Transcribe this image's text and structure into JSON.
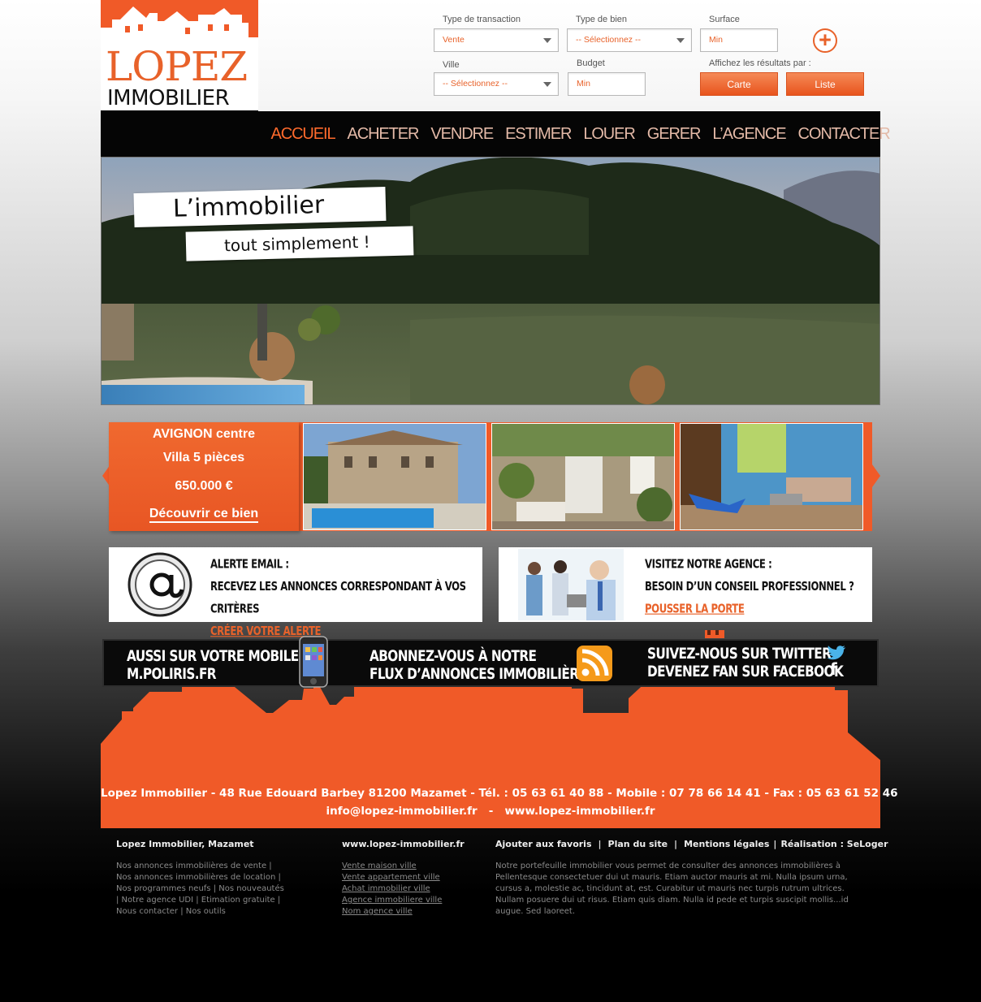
{
  "brand": {
    "name_line1": "LOPEZ",
    "name_line2": "IMMOBILIER",
    "color": "#f05a28"
  },
  "search": {
    "transaction_label": "Type de transaction",
    "transaction_value": "Vente",
    "bien_label": "Type de bien",
    "bien_value": "-- Sélectionnez --",
    "surface_label": "Surface",
    "surface_placeholder": "Min",
    "ville_label": "Ville",
    "ville_value": "-- Sélectionnez --",
    "budget_label": "Budget",
    "budget_placeholder": "Min",
    "results_label": "Affichez les résultats par :",
    "map_button": "Carte",
    "list_button": "Liste",
    "plus_icon": "plus-circle-icon"
  },
  "nav": {
    "items": [
      "ACCUEIL",
      "ACHETER",
      "VENDRE",
      "ESTIMER",
      "LOUER",
      "GERER",
      "L’AGENCE",
      "CONTACTER"
    ],
    "active": "ACCUEIL"
  },
  "hero": {
    "line1": "L’immobilier",
    "line2": "tout simplement !"
  },
  "carousel": {
    "city": "AVIGNON centre",
    "type": "Villa 5 pièces",
    "price": "650.000 €",
    "cta": "Découvrir ce bien"
  },
  "alert_box": {
    "title": "Alerte email :",
    "text": "Recevez les annonces correspondant à vos critères",
    "link": "Créer votre alerte"
  },
  "agency_box": {
    "title": "Visitez notre agence :",
    "text": "Besoin d’un conseil professionnel ?",
    "link": "Pousser la porte"
  },
  "social": {
    "mobile_line1": "Aussi sur votre  mobile",
    "mobile_line2": "M.POLIRIS.FR",
    "rss_line1": "Abonnez-vous à notre",
    "rss_line2": "flux d’annonces immobilières",
    "twitter_line": "Suivez-nous sur Twitter",
    "facebook_line": "Devenez fan sur Facebook"
  },
  "contact": {
    "line1": "Lopez Immobilier  -  48 Rue Edouard Barbey 81200 Mazamet  -  Tél. : 05 63 61 40 88  - Mobile : 07 78 66 14 41  - Fax : 05 63 61 52 46",
    "email": "info@lopez-immobilier.fr",
    "website": "www.lopez-immobilier.fr"
  },
  "footer": {
    "col1_title": "Lopez Immobilier, Mazamet",
    "col1_lines": [
      "Nos annonces immobilières de vente |",
      "Nos annonces immobilières de location |",
      "Nos programmes neufs | Nos nouveautés",
      "| Notre agence UDI | Etimation gratuite |",
      "Nous contacter | Nos outils"
    ],
    "col2_title": "www.lopez-immobilier.fr",
    "col2_links": [
      "Vente maison ville",
      "Vente appartement ville",
      "Achat immobilier ville",
      "Agence immobiliere ville ",
      "Nom agence ville"
    ],
    "col3_links": [
      "Ajouter aux favoris",
      "Plan du site",
      "Mentions légales",
      "Réalisation : SeLoger"
    ],
    "col3_text": "Notre portefeuille immobilier vous permet de consulter des annonces immobilières à Pellentesque consectetuer dui ut mauris. Etiam auctor mauris at mi. Nulla ipsum urna, cursus a, molestie ac, tincidunt at, est. Curabitur ut mauris nec turpis rutrum ultrices. Nullam posuere dui ut risus. Etiam quis diam. Nulla id pede et turpis suscipit mollis...id augue. Sed laoreet."
  }
}
